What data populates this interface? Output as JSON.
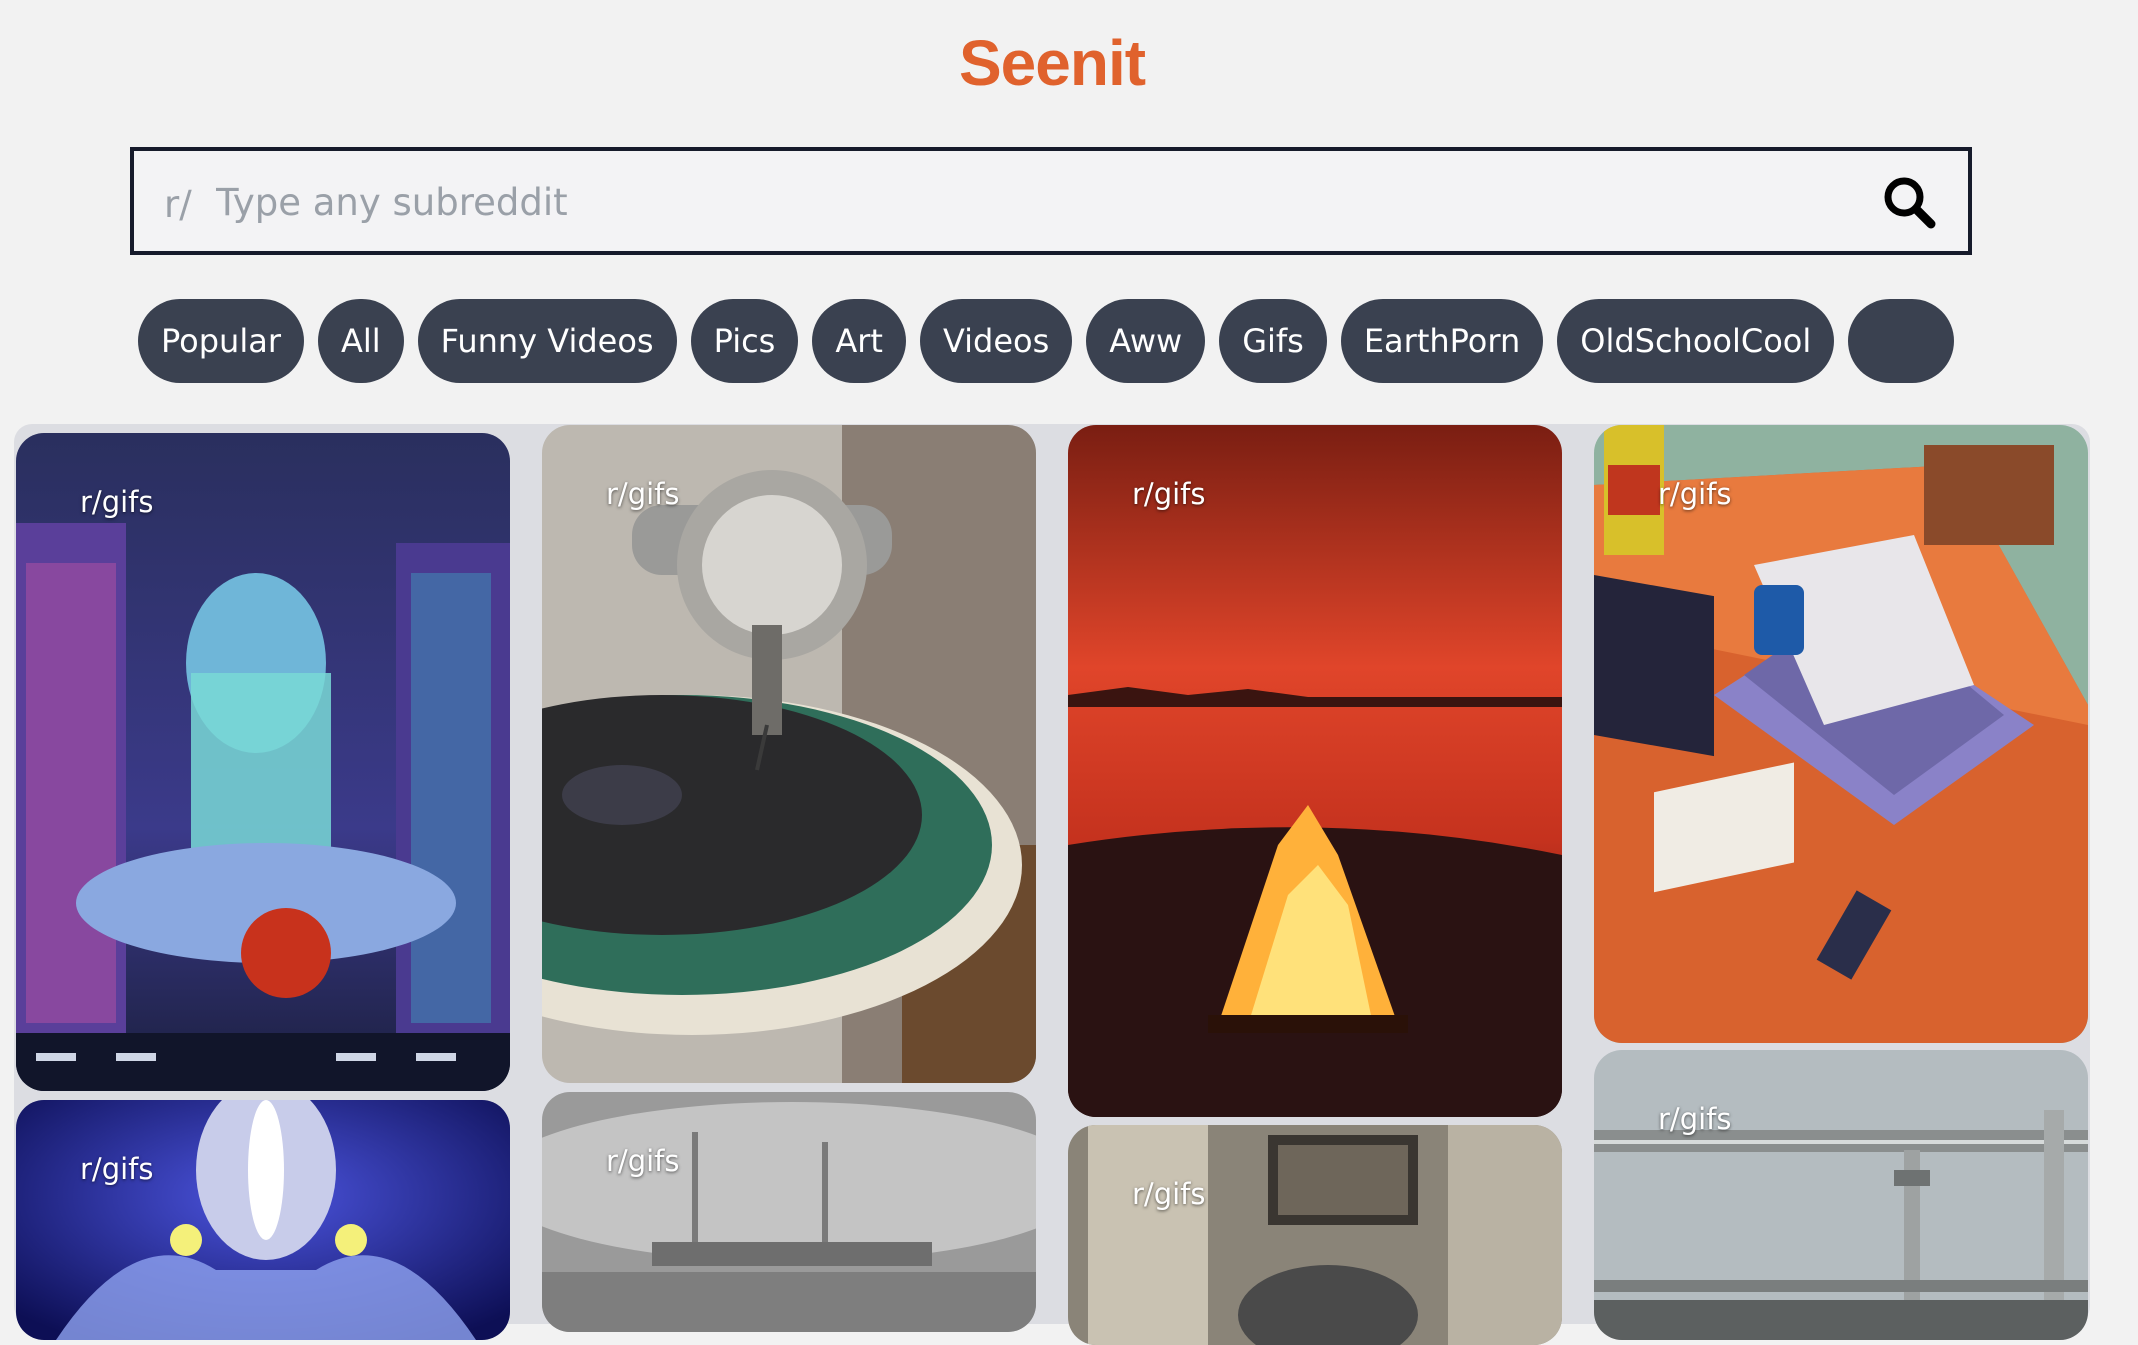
{
  "app": {
    "title": "Seenit"
  },
  "search": {
    "prefix": "r/",
    "placeholder": "Type any subreddit",
    "icon": "search-icon"
  },
  "chips": [
    "Popular",
    "All",
    "Funny Videos",
    "Pics",
    "Art",
    "Videos",
    "Aww",
    "Gifs",
    "EarthPorn",
    "OldSchoolCool",
    ""
  ],
  "cards": [
    {
      "subreddit": "r/gifs",
      "image": "anime girl hugging neon sign in city"
    },
    {
      "subreddit": "r/gifs",
      "image": "helmet figure blue glow"
    },
    {
      "subreddit": "r/gifs",
      "image": "gramophone record player"
    },
    {
      "subreddit": "r/gifs",
      "image": "foggy black and white ship"
    },
    {
      "subreddit": "r/gifs",
      "image": "campfire on beach at red sunset"
    },
    {
      "subreddit": "r/gifs",
      "image": "room interior"
    },
    {
      "subreddit": "r/gifs",
      "image": "isometric desk with laptops"
    },
    {
      "subreddit": "r/gifs",
      "image": "metal railing foggy sky"
    }
  ],
  "colors": {
    "brand": "#e0622d",
    "chip": "#3a4150",
    "background": "#f2f2f2",
    "grid": "#dcdde2"
  }
}
